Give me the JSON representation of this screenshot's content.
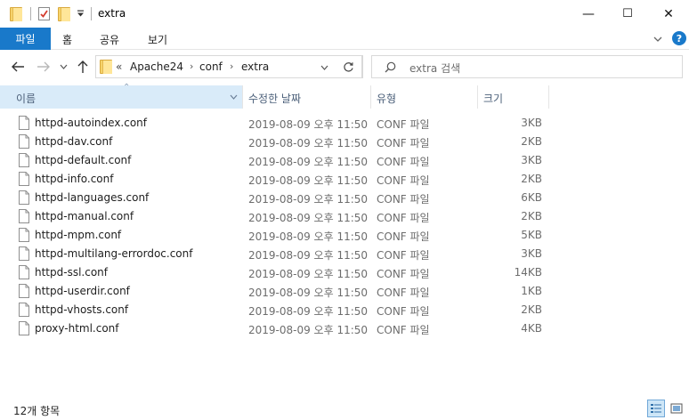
{
  "window": {
    "title": "extra",
    "controls": {
      "minimize": "—",
      "maximize": "☐",
      "close": "✕"
    }
  },
  "ribbon": {
    "tabs": [
      "파일",
      "홈",
      "공유",
      "보기"
    ],
    "help": "?"
  },
  "nav": {
    "address_prefix": "«",
    "breadcrumbs": [
      "Apache24",
      "conf",
      "extra"
    ],
    "search_placeholder": "extra 검색"
  },
  "columns": {
    "name": "이름",
    "date": "수정한 날짜",
    "type": "유형",
    "size": "크기"
  },
  "files": [
    {
      "name": "httpd-autoindex.conf",
      "date": "2019-08-09 오후 11:50",
      "type": "CONF 파일",
      "size": "3KB"
    },
    {
      "name": "httpd-dav.conf",
      "date": "2019-08-09 오후 11:50",
      "type": "CONF 파일",
      "size": "2KB"
    },
    {
      "name": "httpd-default.conf",
      "date": "2019-08-09 오후 11:50",
      "type": "CONF 파일",
      "size": "3KB"
    },
    {
      "name": "httpd-info.conf",
      "date": "2019-08-09 오후 11:50",
      "type": "CONF 파일",
      "size": "2KB"
    },
    {
      "name": "httpd-languages.conf",
      "date": "2019-08-09 오후 11:50",
      "type": "CONF 파일",
      "size": "6KB"
    },
    {
      "name": "httpd-manual.conf",
      "date": "2019-08-09 오후 11:50",
      "type": "CONF 파일",
      "size": "2KB"
    },
    {
      "name": "httpd-mpm.conf",
      "date": "2019-08-09 오후 11:50",
      "type": "CONF 파일",
      "size": "5KB"
    },
    {
      "name": "httpd-multilang-errordoc.conf",
      "date": "2019-08-09 오후 11:50",
      "type": "CONF 파일",
      "size": "3KB"
    },
    {
      "name": "httpd-ssl.conf",
      "date": "2019-08-09 오후 11:50",
      "type": "CONF 파일",
      "size": "14KB"
    },
    {
      "name": "httpd-userdir.conf",
      "date": "2019-08-09 오후 11:50",
      "type": "CONF 파일",
      "size": "1KB"
    },
    {
      "name": "httpd-vhosts.conf",
      "date": "2019-08-09 오후 11:50",
      "type": "CONF 파일",
      "size": "2KB"
    },
    {
      "name": "proxy-html.conf",
      "date": "2019-08-09 오후 11:50",
      "type": "CONF 파일",
      "size": "4KB"
    }
  ],
  "status": {
    "item_count": "12개 항목"
  },
  "colors": {
    "accent": "#1979ca",
    "header_selected": "#d9ebf9",
    "folder": "#f6d36b"
  }
}
